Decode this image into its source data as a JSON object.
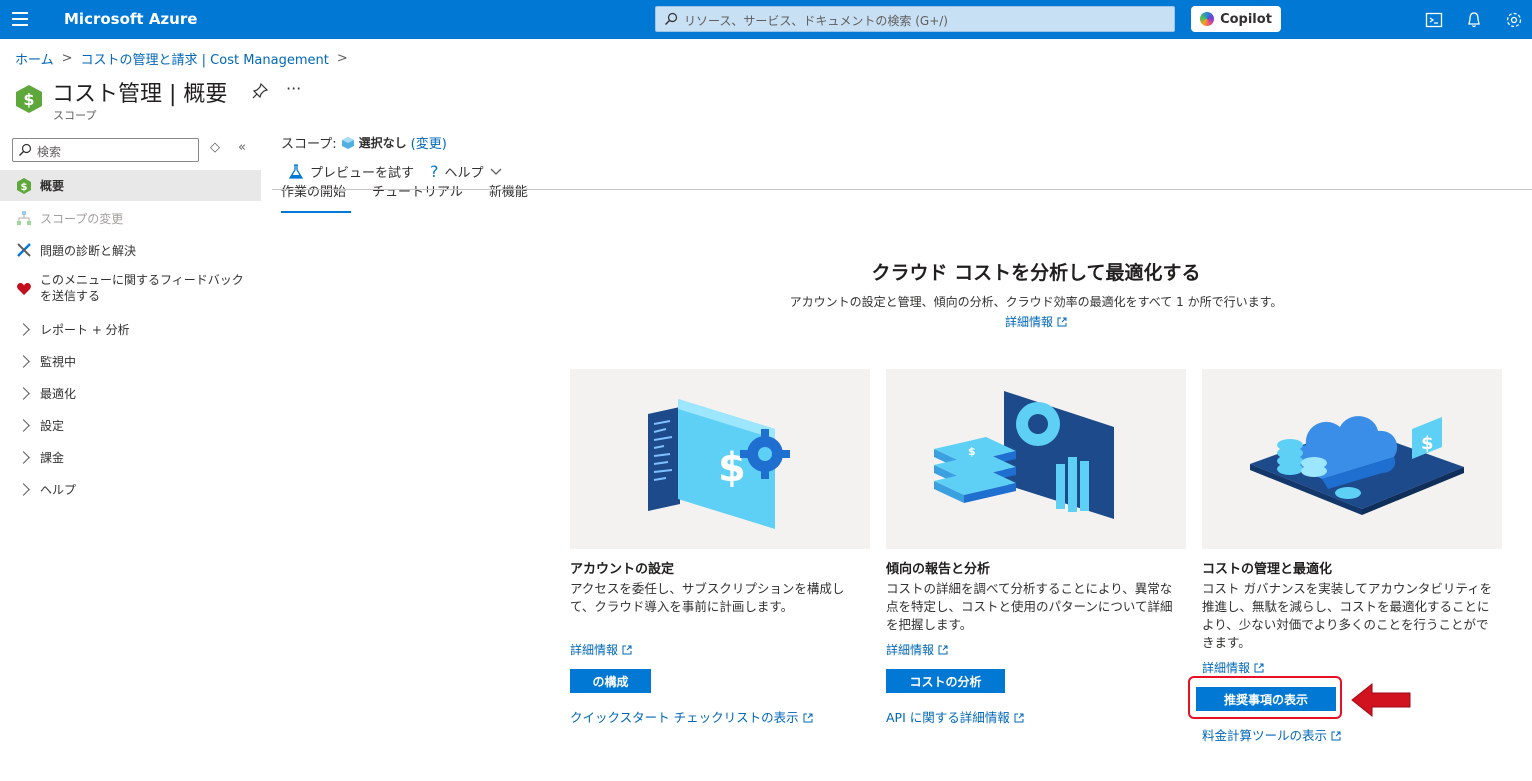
{
  "topbar": {
    "brand": "Microsoft Azure",
    "search_placeholder": "リソース、サービス、ドキュメントの検索 (G+/)",
    "copilot_label": "Copilot"
  },
  "breadcrumb": [
    "ホーム",
    "コストの管理と請求 | Cost Management"
  ],
  "title": "コスト管理 | 概要",
  "title_sub": "スコープ",
  "sidebar": {
    "search_placeholder": "検索",
    "items": [
      {
        "label": "概要"
      },
      {
        "label": "スコープの変更"
      },
      {
        "label": "問題の診断と解決"
      },
      {
        "label": "このメニューに関するフィードバックを送信する"
      },
      {
        "label": "レポート + 分析"
      },
      {
        "label": "監視中"
      },
      {
        "label": "最適化"
      },
      {
        "label": "設定"
      },
      {
        "label": "課金"
      },
      {
        "label": "ヘルプ"
      }
    ]
  },
  "scope": {
    "label": "スコープ:",
    "value": "選択なし",
    "change": "(変更)"
  },
  "toolbar": {
    "preview": "プレビューを試す",
    "help": "ヘルプ"
  },
  "tabs": [
    "作業の開始",
    "チュートリアル",
    "新機能"
  ],
  "hero": {
    "title": "クラウド コストを分析して最適化する",
    "subtitle": "アカウントの設定と管理、傾向の分析、クラウド効率の最適化をすべて 1 か所で行います。",
    "link": "詳細情報"
  },
  "cards": [
    {
      "title": "アカウントの設定",
      "desc": "アクセスを委任し、サブスクリプションを構成して、クラウド導入を事前に計画します。",
      "learn": "詳細情報",
      "button": "の構成",
      "bottom": "クイックスタート チェックリストの表示"
    },
    {
      "title": "傾向の報告と分析",
      "desc": "コストの詳細を調べて分析することにより、異常な点を特定し、コストと使用のパターンについて詳細を把握します。",
      "learn": "詳細情報",
      "button": "コストの分析",
      "bottom": "API に関する詳細情報"
    },
    {
      "title": "コストの管理と最適化",
      "desc": "コスト ガバナンスを実装してアカウンタビリティを推進し、無駄を減らし、コストを最適化することにより、少ない対価でより多くのことを行うことができます。",
      "learn": "詳細情報",
      "button": "推奨事項の表示",
      "bottom": "料金計算ツールの表示"
    }
  ],
  "colors": {
    "accent": "#0078d4",
    "highlight": "#e81123"
  }
}
